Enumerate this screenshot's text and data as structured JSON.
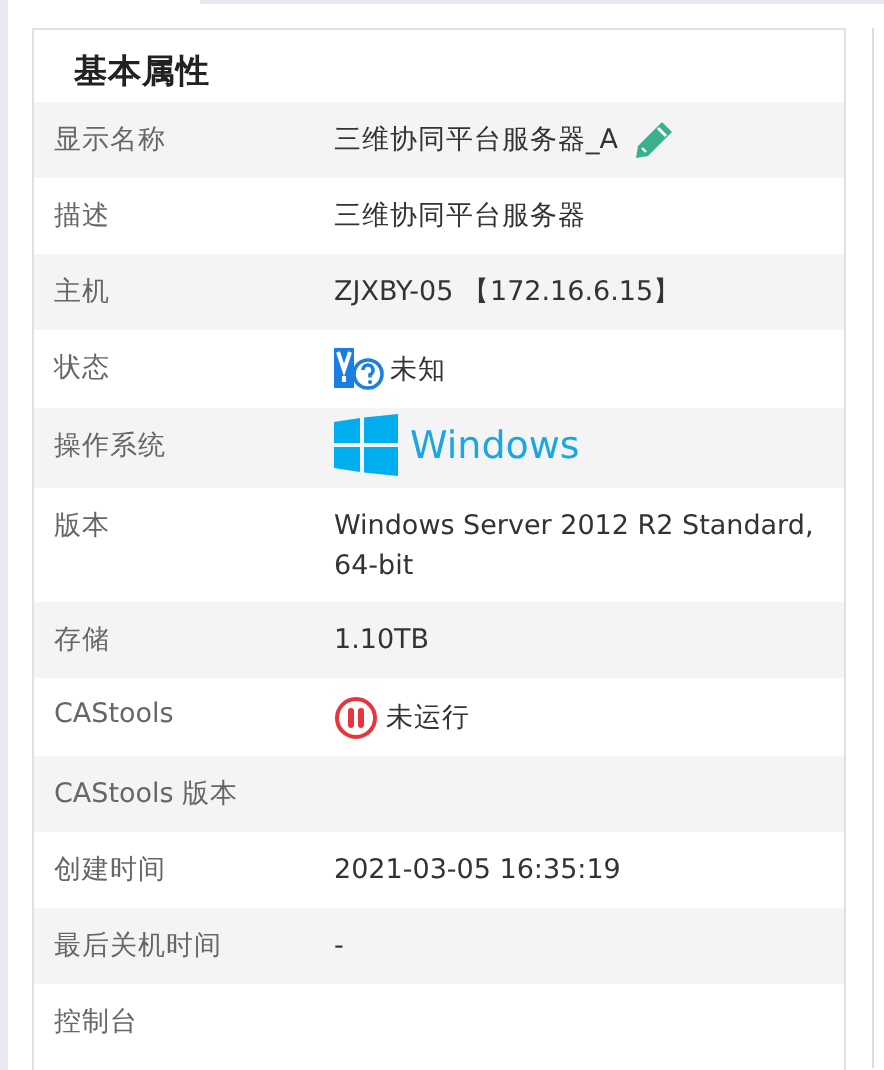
{
  "panel": {
    "title": "基本属性",
    "rows": [
      {
        "label": "显示名称",
        "value": "三维协同平台服务器_A",
        "kind": "editable"
      },
      {
        "label": "描述",
        "value": "三维协同平台服务器",
        "kind": "text"
      },
      {
        "label": "主机",
        "value": "ZJXBY-05 【172.16.6.15】",
        "kind": "text"
      },
      {
        "label": "状态",
        "value": "未知",
        "kind": "unknown-status"
      },
      {
        "label": "操作系统",
        "value": "Windows",
        "kind": "os"
      },
      {
        "label": "版本",
        "value": "Windows Server 2012 R2 Standard, 64-bit",
        "kind": "text"
      },
      {
        "label": "存储",
        "value": "1.10TB",
        "kind": "text"
      },
      {
        "label": "CAStools",
        "value": "未运行",
        "kind": "not-running"
      },
      {
        "label": "CAStools 版本",
        "kind": "text"
      },
      {
        "label": "创建时间",
        "value": "2021-03-05 16:35:19",
        "kind": "text"
      },
      {
        "label": "最后关机时间",
        "value": "-",
        "kind": "text"
      },
      {
        "label": "控制台",
        "kind": "text"
      }
    ]
  }
}
